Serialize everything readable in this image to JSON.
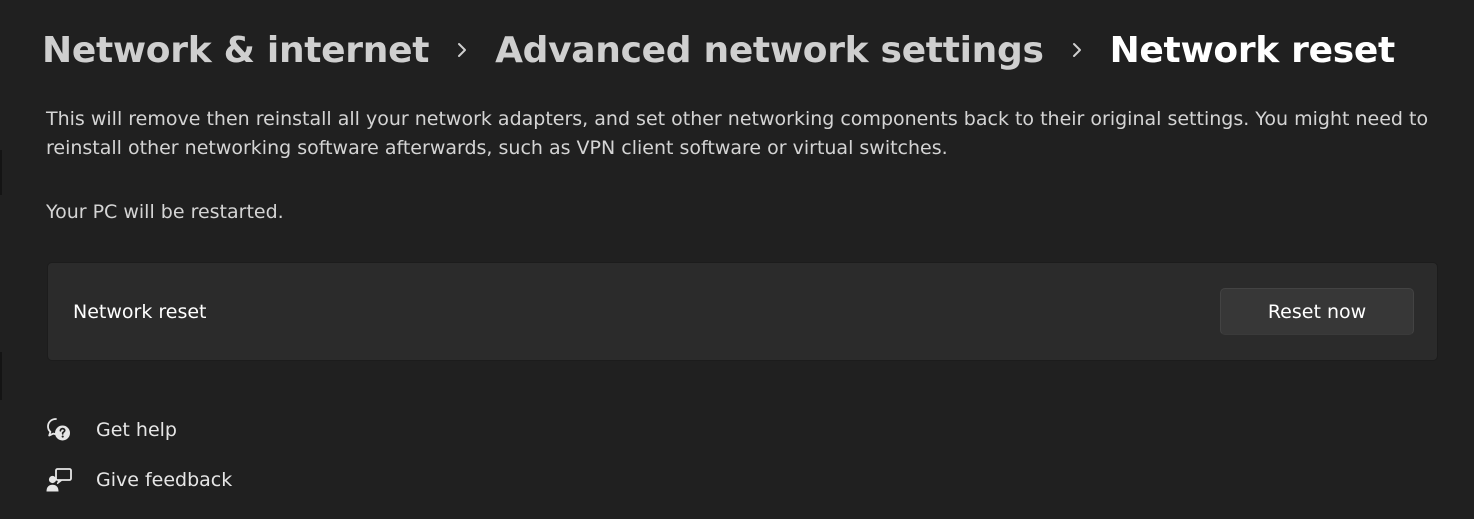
{
  "breadcrumb": {
    "items": [
      "Network & internet",
      "Advanced network settings",
      "Network reset"
    ]
  },
  "description": "This will remove then reinstall all your network adapters, and set other networking components back to their original settings. You might need to reinstall other networking software afterwards, such as VPN client software or virtual switches.",
  "restart_note": "Your PC will be restarted.",
  "card": {
    "label": "Network reset",
    "button_label": "Reset now"
  },
  "links": {
    "help": {
      "label": "Get help",
      "icon": "help-chat-icon"
    },
    "feedback": {
      "label": "Give feedback",
      "icon": "feedback-person-icon"
    }
  },
  "colors": {
    "background": "#202020",
    "card": "#2b2b2b",
    "button": "#373737",
    "text": "#ffffff",
    "muted_text": "#cfcfcf"
  }
}
